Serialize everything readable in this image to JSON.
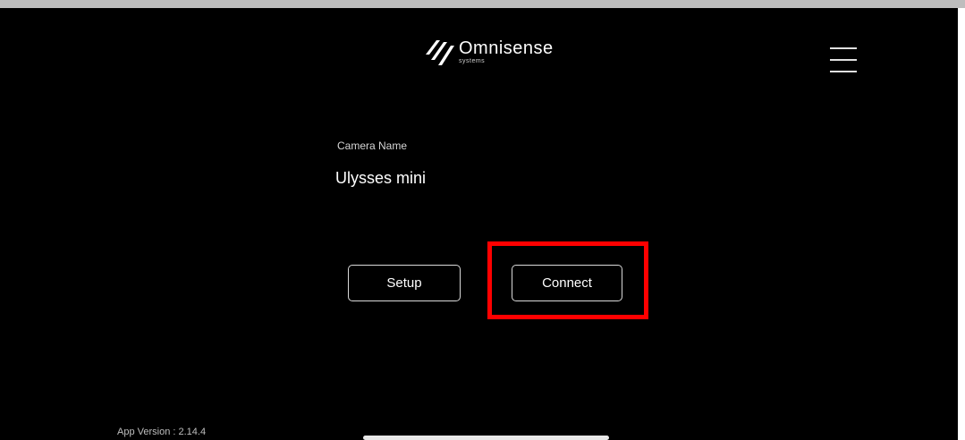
{
  "header": {
    "logo": {
      "name": "Omnisense",
      "subtitle": "systems",
      "icon": "omnisense-logo-mark"
    },
    "menu_icon": "hamburger-menu-icon"
  },
  "camera": {
    "label": "Camera Name",
    "value": "Ulysses mini"
  },
  "buttons": {
    "setup_label": "Setup",
    "connect_label": "Connect"
  },
  "highlight_color": "#ff0000",
  "footer": {
    "app_version": "App Version : 2.14.4"
  }
}
